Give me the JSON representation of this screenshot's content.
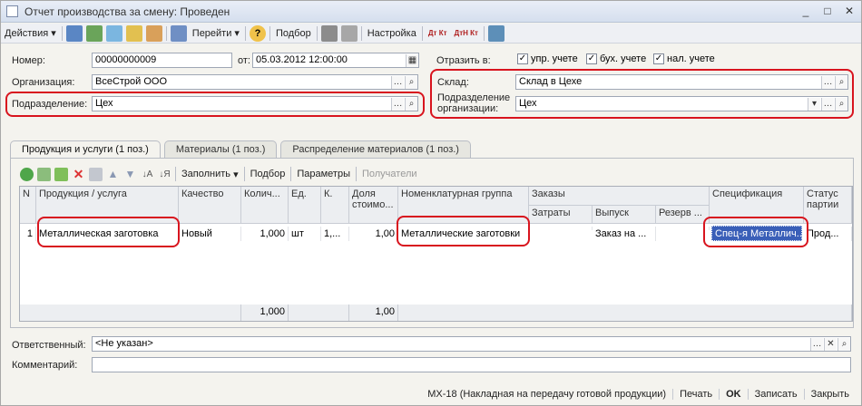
{
  "window": {
    "title": "Отчет производства за смену: Проведен",
    "controls": [
      "_",
      "□",
      "✕"
    ]
  },
  "toolbar": {
    "actions": "Действия",
    "goto": "Перейти",
    "help": "?",
    "podbor": "Подбор",
    "settings": "Настройка",
    "dtkt1": "Дт Кт",
    "dtkt2": "ДтН Кт"
  },
  "form": {
    "number_label": "Номер:",
    "number_value": "00000000009",
    "date_label": "от:",
    "date_value": "05.03.2012 12:00:00",
    "reflect_label": "Отразить в:",
    "check_upr": "упр. учете",
    "check_buh": "бух. учете",
    "check_nal": "нал. учете",
    "org_label": "Организация:",
    "org_value": "ВсеСтрой ООО",
    "subdiv_label": "Подразделение:",
    "subdiv_value": "Цех",
    "warehouse_label": "Склад:",
    "warehouse_value": "Склад в Цехе",
    "org_subdiv_label1": "Подразделение",
    "org_subdiv_label2": "организации:",
    "org_subdiv_value": "Цех"
  },
  "tabs": [
    {
      "label": "Продукция и услуги (1 поз.)"
    },
    {
      "label": "Материалы (1 поз.)"
    },
    {
      "label": "Распределение материалов (1 поз.)"
    }
  ],
  "table_toolbar": {
    "fill": "Заполнить",
    "podbor": "Подбор",
    "params": "Параметры",
    "recipients": "Получатели"
  },
  "table": {
    "headers": {
      "n": "N",
      "product": "Продукция / услуга",
      "quality": "Качество",
      "qty": "Колич...",
      "unit": "Ед.",
      "k": "К.",
      "share1": "Доля",
      "share2": "стоимо...",
      "nomgroup": "Номенклатурная группа",
      "orders": "Заказы",
      "costs": "Затраты",
      "release": "Выпуск",
      "reserve": "Резерв ...",
      "spec": "Спецификация",
      "status1": "Статус",
      "status2": "партии"
    },
    "row": {
      "n": "1",
      "product": "Металлическая заготовка",
      "quality": "Новый",
      "qty": "1,000",
      "unit": "шт",
      "k": "1,...",
      "share": "1,00",
      "nomgroup": "Металлические заготовки",
      "costs": "",
      "release": "Заказ на ...",
      "reserve": "",
      "spec": "Спец-я Металлич...",
      "status": "Прод..."
    },
    "footer": {
      "qty": "1,000",
      "share": "1,00"
    }
  },
  "bottom": {
    "responsible_label": "Ответственный:",
    "responsible_value": "<Не указан>",
    "comment_label": "Комментарий:",
    "comment_value": ""
  },
  "statusbar": {
    "print_form": "МХ-18 (Накладная на передачу готовой продукции)",
    "print": "Печать",
    "ok": "OK",
    "save": "Записать",
    "close": "Закрыть"
  },
  "colors": {
    "highlight": "#d8141e",
    "selection": "#3a5fb8"
  }
}
